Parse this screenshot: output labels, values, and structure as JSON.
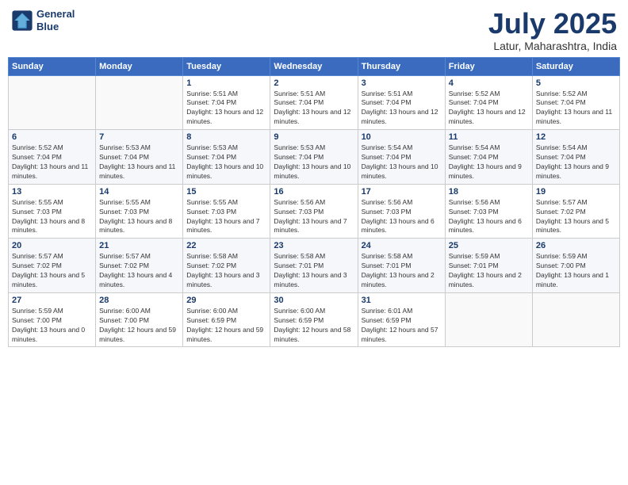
{
  "header": {
    "logo_line1": "General",
    "logo_line2": "Blue",
    "month_title": "July 2025",
    "location": "Latur, Maharashtra, India"
  },
  "weekdays": [
    "Sunday",
    "Monday",
    "Tuesday",
    "Wednesday",
    "Thursday",
    "Friday",
    "Saturday"
  ],
  "weeks": [
    [
      {
        "day": "",
        "sunrise": "",
        "sunset": "",
        "daylight": ""
      },
      {
        "day": "",
        "sunrise": "",
        "sunset": "",
        "daylight": ""
      },
      {
        "day": "1",
        "sunrise": "Sunrise: 5:51 AM",
        "sunset": "Sunset: 7:04 PM",
        "daylight": "Daylight: 13 hours and 12 minutes."
      },
      {
        "day": "2",
        "sunrise": "Sunrise: 5:51 AM",
        "sunset": "Sunset: 7:04 PM",
        "daylight": "Daylight: 13 hours and 12 minutes."
      },
      {
        "day": "3",
        "sunrise": "Sunrise: 5:51 AM",
        "sunset": "Sunset: 7:04 PM",
        "daylight": "Daylight: 13 hours and 12 minutes."
      },
      {
        "day": "4",
        "sunrise": "Sunrise: 5:52 AM",
        "sunset": "Sunset: 7:04 PM",
        "daylight": "Daylight: 13 hours and 12 minutes."
      },
      {
        "day": "5",
        "sunrise": "Sunrise: 5:52 AM",
        "sunset": "Sunset: 7:04 PM",
        "daylight": "Daylight: 13 hours and 11 minutes."
      }
    ],
    [
      {
        "day": "6",
        "sunrise": "Sunrise: 5:52 AM",
        "sunset": "Sunset: 7:04 PM",
        "daylight": "Daylight: 13 hours and 11 minutes."
      },
      {
        "day": "7",
        "sunrise": "Sunrise: 5:53 AM",
        "sunset": "Sunset: 7:04 PM",
        "daylight": "Daylight: 13 hours and 11 minutes."
      },
      {
        "day": "8",
        "sunrise": "Sunrise: 5:53 AM",
        "sunset": "Sunset: 7:04 PM",
        "daylight": "Daylight: 13 hours and 10 minutes."
      },
      {
        "day": "9",
        "sunrise": "Sunrise: 5:53 AM",
        "sunset": "Sunset: 7:04 PM",
        "daylight": "Daylight: 13 hours and 10 minutes."
      },
      {
        "day": "10",
        "sunrise": "Sunrise: 5:54 AM",
        "sunset": "Sunset: 7:04 PM",
        "daylight": "Daylight: 13 hours and 10 minutes."
      },
      {
        "day": "11",
        "sunrise": "Sunrise: 5:54 AM",
        "sunset": "Sunset: 7:04 PM",
        "daylight": "Daylight: 13 hours and 9 minutes."
      },
      {
        "day": "12",
        "sunrise": "Sunrise: 5:54 AM",
        "sunset": "Sunset: 7:04 PM",
        "daylight": "Daylight: 13 hours and 9 minutes."
      }
    ],
    [
      {
        "day": "13",
        "sunrise": "Sunrise: 5:55 AM",
        "sunset": "Sunset: 7:03 PM",
        "daylight": "Daylight: 13 hours and 8 minutes."
      },
      {
        "day": "14",
        "sunrise": "Sunrise: 5:55 AM",
        "sunset": "Sunset: 7:03 PM",
        "daylight": "Daylight: 13 hours and 8 minutes."
      },
      {
        "day": "15",
        "sunrise": "Sunrise: 5:55 AM",
        "sunset": "Sunset: 7:03 PM",
        "daylight": "Daylight: 13 hours and 7 minutes."
      },
      {
        "day": "16",
        "sunrise": "Sunrise: 5:56 AM",
        "sunset": "Sunset: 7:03 PM",
        "daylight": "Daylight: 13 hours and 7 minutes."
      },
      {
        "day": "17",
        "sunrise": "Sunrise: 5:56 AM",
        "sunset": "Sunset: 7:03 PM",
        "daylight": "Daylight: 13 hours and 6 minutes."
      },
      {
        "day": "18",
        "sunrise": "Sunrise: 5:56 AM",
        "sunset": "Sunset: 7:03 PM",
        "daylight": "Daylight: 13 hours and 6 minutes."
      },
      {
        "day": "19",
        "sunrise": "Sunrise: 5:57 AM",
        "sunset": "Sunset: 7:02 PM",
        "daylight": "Daylight: 13 hours and 5 minutes."
      }
    ],
    [
      {
        "day": "20",
        "sunrise": "Sunrise: 5:57 AM",
        "sunset": "Sunset: 7:02 PM",
        "daylight": "Daylight: 13 hours and 5 minutes."
      },
      {
        "day": "21",
        "sunrise": "Sunrise: 5:57 AM",
        "sunset": "Sunset: 7:02 PM",
        "daylight": "Daylight: 13 hours and 4 minutes."
      },
      {
        "day": "22",
        "sunrise": "Sunrise: 5:58 AM",
        "sunset": "Sunset: 7:02 PM",
        "daylight": "Daylight: 13 hours and 3 minutes."
      },
      {
        "day": "23",
        "sunrise": "Sunrise: 5:58 AM",
        "sunset": "Sunset: 7:01 PM",
        "daylight": "Daylight: 13 hours and 3 minutes."
      },
      {
        "day": "24",
        "sunrise": "Sunrise: 5:58 AM",
        "sunset": "Sunset: 7:01 PM",
        "daylight": "Daylight: 13 hours and 2 minutes."
      },
      {
        "day": "25",
        "sunrise": "Sunrise: 5:59 AM",
        "sunset": "Sunset: 7:01 PM",
        "daylight": "Daylight: 13 hours and 2 minutes."
      },
      {
        "day": "26",
        "sunrise": "Sunrise: 5:59 AM",
        "sunset": "Sunset: 7:00 PM",
        "daylight": "Daylight: 13 hours and 1 minute."
      }
    ],
    [
      {
        "day": "27",
        "sunrise": "Sunrise: 5:59 AM",
        "sunset": "Sunset: 7:00 PM",
        "daylight": "Daylight: 13 hours and 0 minutes."
      },
      {
        "day": "28",
        "sunrise": "Sunrise: 6:00 AM",
        "sunset": "Sunset: 7:00 PM",
        "daylight": "Daylight: 12 hours and 59 minutes."
      },
      {
        "day": "29",
        "sunrise": "Sunrise: 6:00 AM",
        "sunset": "Sunset: 6:59 PM",
        "daylight": "Daylight: 12 hours and 59 minutes."
      },
      {
        "day": "30",
        "sunrise": "Sunrise: 6:00 AM",
        "sunset": "Sunset: 6:59 PM",
        "daylight": "Daylight: 12 hours and 58 minutes."
      },
      {
        "day": "31",
        "sunrise": "Sunrise: 6:01 AM",
        "sunset": "Sunset: 6:59 PM",
        "daylight": "Daylight: 12 hours and 57 minutes."
      },
      {
        "day": "",
        "sunrise": "",
        "sunset": "",
        "daylight": ""
      },
      {
        "day": "",
        "sunrise": "",
        "sunset": "",
        "daylight": ""
      }
    ]
  ]
}
